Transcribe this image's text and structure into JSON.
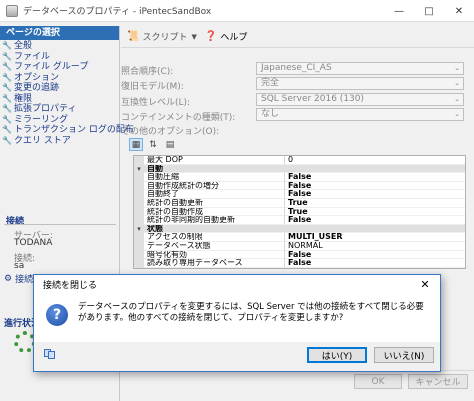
{
  "window": {
    "title": "データベースのプロパティ - iPentecSandBox"
  },
  "left": {
    "select_page_label": "ページの選択",
    "pages": [
      "全般",
      "ファイル",
      "ファイル グループ",
      "オプション",
      "変更の追跡",
      "権限",
      "拡張プロパティ",
      "ミラーリング",
      "トランザクション ログの配布",
      "クエリ ストア"
    ],
    "connection": {
      "heading": "接続",
      "server_label": "サーバー:",
      "server_value": "TODANA",
      "conn_label": "接続:",
      "conn_value": "sa",
      "link_label": "接続のプロパティの表示"
    },
    "progress_heading": "進行状況"
  },
  "toolbar": {
    "script_label": "スクリプト",
    "help_label": "ヘルプ"
  },
  "form": {
    "rows": [
      {
        "label": "照合順序(C):",
        "value": "Japanese_CI_AS"
      },
      {
        "label": "復旧モデル(M):",
        "value": "完全"
      },
      {
        "label": "互換性レベル(L):",
        "value": "SQL Server 2016 (130)"
      },
      {
        "label": "コンテインメントの種類(T):",
        "value": "なし"
      }
    ],
    "other_options_label": "その他のオプション(O):"
  },
  "grid": {
    "rows": [
      {
        "kind": "prop",
        "key": "最大 DOP",
        "value": "0"
      },
      {
        "kind": "cat",
        "key": "自動"
      },
      {
        "kind": "prop",
        "key": "自動圧縮",
        "value": "False",
        "bold": true
      },
      {
        "kind": "prop",
        "key": "自動作成統計の増分",
        "value": "False",
        "bold": true
      },
      {
        "kind": "prop",
        "key": "自動終了",
        "value": "False",
        "bold": true
      },
      {
        "kind": "prop",
        "key": "統計の自動更新",
        "value": "True",
        "bold": true
      },
      {
        "kind": "prop",
        "key": "統計の自動作成",
        "value": "True",
        "bold": true
      },
      {
        "kind": "prop",
        "key": "統計の非同期的自動更新",
        "value": "False",
        "bold": true
      },
      {
        "kind": "cat",
        "key": "状態"
      },
      {
        "kind": "prop",
        "key": "アクセスの制限",
        "value": "MULTI_USER",
        "bold": true
      },
      {
        "kind": "prop",
        "key": "データベース状態",
        "value": "NORMAL"
      },
      {
        "kind": "prop",
        "key": "暗号化有効",
        "value": "False",
        "bold": true
      },
      {
        "kind": "prop",
        "key": "読み取り専用データベース",
        "value": "False",
        "bold": true
      }
    ]
  },
  "footer": {
    "ok_label": "OK",
    "cancel_label": "キャンセル"
  },
  "dialog": {
    "title": "接続を閉じる",
    "message": "データベースのプロパティを変更するには、SQL Server では他の接続をすべて閉じる必要があります。他のすべての接続を閉じて、プロパティを変更しますか?",
    "yes_label": "はい(Y)",
    "no_label": "いいえ(N)"
  }
}
